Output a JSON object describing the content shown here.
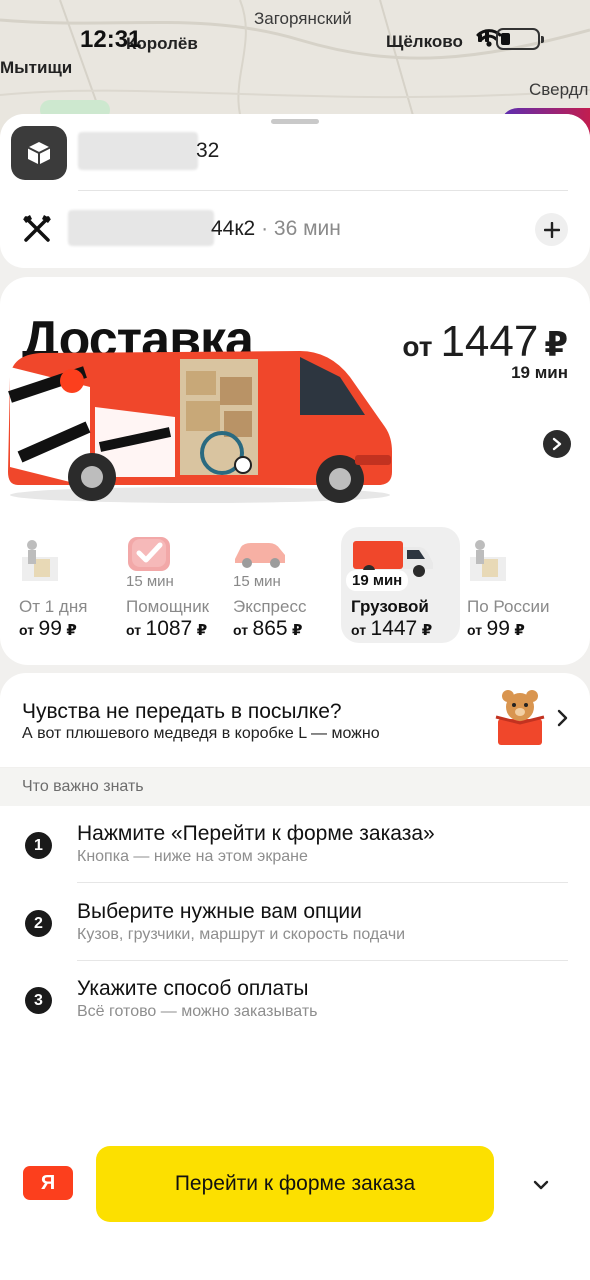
{
  "status_bar": {
    "time": "12:31"
  },
  "map": {
    "labels": {
      "zagoryansky": "Загорянский",
      "korolev": "Королёв",
      "mytishchi": "Мытищи",
      "shchelkovo": "Щёлково",
      "sverdl": "Свердл"
    }
  },
  "addresses": {
    "from": {
      "visible_text": "32"
    },
    "to": {
      "visible_text": "44к2",
      "eta": " · 36 мин"
    }
  },
  "hero": {
    "title": "Доставка",
    "price_prefix": "от",
    "price_amount": "1447",
    "currency": "₽",
    "eta": "19 мин"
  },
  "tariffs": [
    {
      "name": "От 1 дня",
      "eta": "",
      "price_prefix": "от",
      "price": "99",
      "currency": "₽",
      "selected": false,
      "icon": "parcel-locker-icon"
    },
    {
      "name": "Помощник",
      "eta": "15 мин",
      "price_prefix": "от",
      "price": "1087",
      "currency": "₽",
      "selected": false,
      "icon": "checkbox-icon"
    },
    {
      "name": "Экспресс",
      "eta": "15 мин",
      "price_prefix": "от",
      "price": "865",
      "currency": "₽",
      "selected": false,
      "icon": "car-icon"
    },
    {
      "name": "Грузовой",
      "eta": "19 мин",
      "price_prefix": "от",
      "price": "1447",
      "currency": "₽",
      "selected": true,
      "icon": "truck-icon"
    },
    {
      "name": "По России",
      "eta": "",
      "price_prefix": "от",
      "price": "99",
      "currency": "₽",
      "selected": false,
      "icon": "parcel-locker-icon"
    }
  ],
  "promo": {
    "title": "Чувства не передать в посылке?",
    "subtitle": "А вот плюшевого медведя в коробке L — можно"
  },
  "info": {
    "heading": "Что важно знать",
    "steps": [
      {
        "num": "1",
        "title": "Нажмите «Перейти к форме заказа»",
        "subtitle": "Кнопка — ниже на этом экране"
      },
      {
        "num": "2",
        "title": "Выберите нужные вам опции",
        "subtitle": "Кузов, грузчики, маршрут и скорость подачи"
      },
      {
        "num": "3",
        "title": "Укажите способ оплаты",
        "subtitle": "Всё готово — можно заказывать"
      }
    ]
  },
  "bottom": {
    "logo": "Я",
    "cta_label": "Перейти к форме заказа"
  },
  "colors": {
    "cta_yellow": "#fce000",
    "brand_red": "#fc3f1d",
    "van_orange": "#f0472b",
    "selected_tariff_bg": "#efefef"
  }
}
